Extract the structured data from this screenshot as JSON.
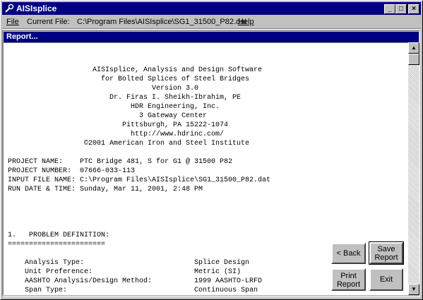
{
  "app": {
    "title": "AISIsplice"
  },
  "menu": {
    "file": "File",
    "current_file_label": "Current File:",
    "current_file_path": "C:\\Program Files\\AISIsplice\\SG1_31500_P82.dat",
    "help": "Help"
  },
  "window_controls": {
    "minimize": "_",
    "maximize": "□",
    "close": "×"
  },
  "report_panel": {
    "title": "Report...",
    "header_lines": [
      "                    AISIsplice, Analysis and Design Software",
      "                      for Bolted Splices of Steel Bridges",
      "                                  Version 3.0",
      "                        Dr. Firas I. Sheikh-Ibrahim, PE",
      "                             HDR Engineering, Inc.",
      "                               3 Gateway Center",
      "                           Pittsburgh, PA 15222-1074",
      "                             http://www.hdrinc.com/",
      "                  ©2001 American Iron and Steel Institute"
    ],
    "project_lines": [
      "PROJECT NAME:    PTC Bridge 481, S for G1 @ 31500 P82",
      "PROJECT NUMBER:  07666-033-113",
      "INPUT FILE NAME: C:\\Program Files\\AISIsplice\\SG1_31500_P82.dat",
      "RUN DATE & TIME: Sunday, Mar 11, 2001, 2:48 PM"
    ],
    "section_heading": "1.   PROBLEM DEFINITION:",
    "section_rule": "=======================",
    "definition_lines": [
      "    Analysis Type:                          Splice Design",
      "    Unit Preference:                        Metric (SI)",
      "    AASHTO Analysis/Design Method:          1999 AASHTO-LRFD",
      "    Span Type:                              Continuous Span"
    ]
  },
  "buttons": {
    "back": "< Back",
    "save_line1": "Save",
    "save_line2": "Report",
    "print_line1": "Print",
    "print_line2": "Report",
    "exit": "Exit"
  },
  "scrollbar": {
    "up_arrow": "▲",
    "down_arrow": "▼"
  }
}
